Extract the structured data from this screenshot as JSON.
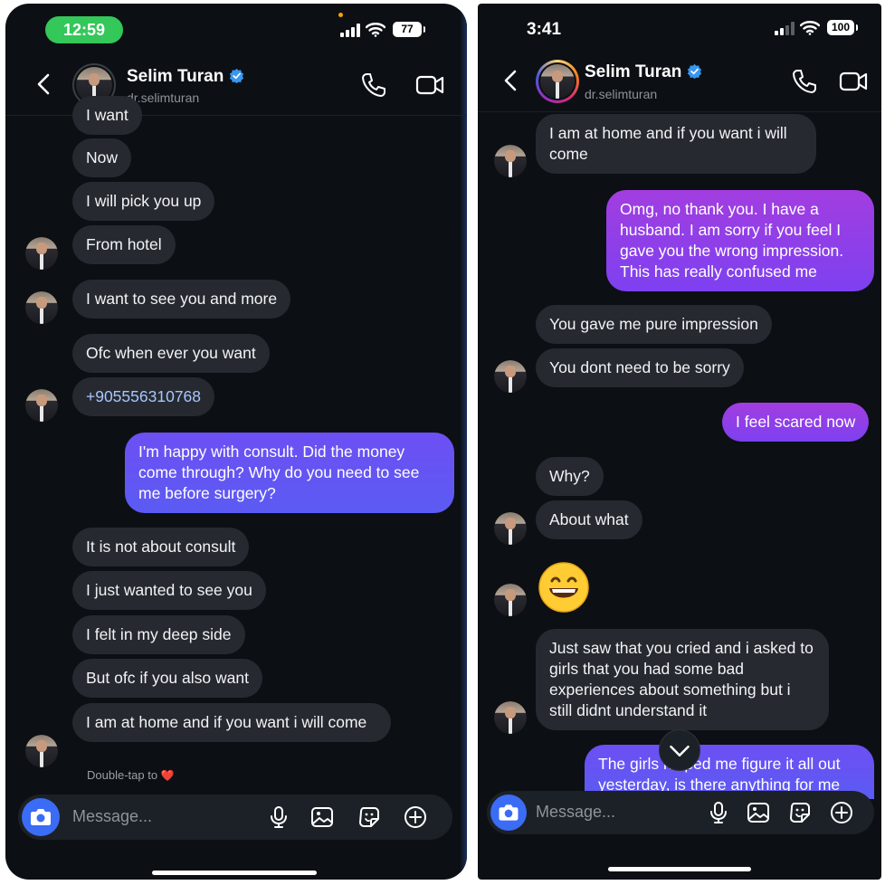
{
  "left": {
    "status": {
      "time": "12:59",
      "battery": "77"
    },
    "header": {
      "name": "Selim Turan",
      "username": "dr.selimturan"
    },
    "messages": [
      "I want",
      "Now",
      "I will pick you up",
      "From hotel",
      "I want to see you and more",
      "Ofc when ever you want",
      "+905556310768",
      "I'm happy with consult. Did the money come through? Why do you need to see me before surgery?",
      "It is not about consult",
      "I just wanted to see you",
      "I felt in my deep side",
      "But ofc if you also want",
      "I am at home and if you want i will come"
    ],
    "hint": "Double-tap to",
    "hint_heart": "❤️",
    "composer": {
      "placeholder": "Message..."
    }
  },
  "right": {
    "status": {
      "time": "3:41",
      "battery": "100"
    },
    "header": {
      "name": "Selim Turan",
      "username": "dr.selimturan"
    },
    "messages": [
      "I am at home and if you want i will come",
      "Omg, no thank you. I have a husband. I am sorry if you feel I gave you the wrong impression. This has really confused me",
      "You gave me pure impression",
      "You dont need to be sorry",
      "I feel scared now",
      "Why?",
      "About what",
      "😄",
      "Just saw that you cried and i asked to girls that you had some bad experiences about something but i still didnt understand it",
      "The girls helped me figure it all out yesterday, is there anything for me"
    ],
    "composer": {
      "placeholder": "Message..."
    }
  },
  "icons": [
    "back-icon",
    "phone-icon",
    "video-icon",
    "verified-badge-icon",
    "camera-icon",
    "microphone-icon",
    "gallery-icon",
    "sticker-icon",
    "plus-circle-icon",
    "chevron-down-icon"
  ],
  "colors": {
    "background": "#0c1014",
    "incoming_bubble": "#262a30",
    "outgoing_purple": "#a23ee0",
    "outgoing_blue": "#6d4ff3",
    "accent": "#3b6cf5",
    "verified": "#3897f0"
  }
}
